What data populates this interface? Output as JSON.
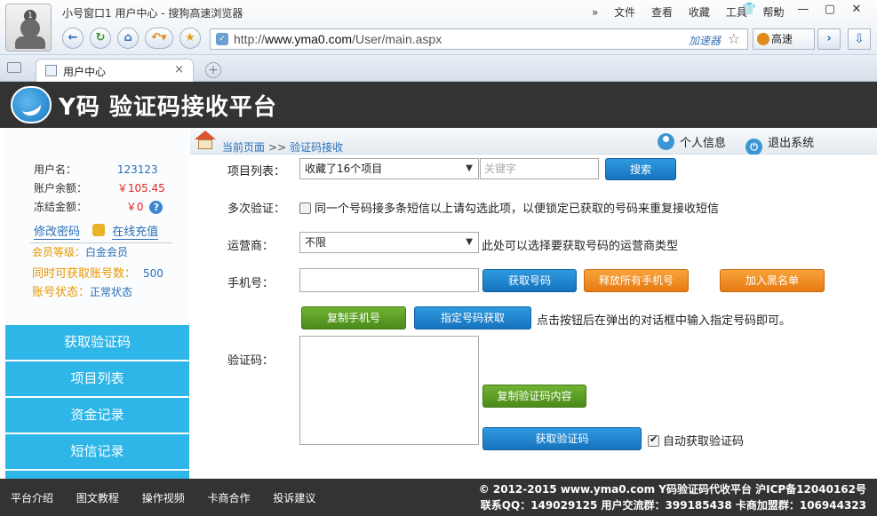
{
  "browser": {
    "window_title": "小号窗口1 用户中心 - 搜狗高速浏览器",
    "avatar_badge": "1",
    "menu": [
      "»",
      "文件",
      "查看",
      "收藏",
      "工具",
      "帮助"
    ],
    "url_prefix": "http://",
    "url_domain": "www.yma0.com",
    "url_path": "/User/main.aspx",
    "accelerator": "加速器",
    "speed_label": "高速",
    "tab_label": "用户中心",
    "tab_close": "×",
    "new_tab": "+"
  },
  "site": {
    "title": "Y码 验证码接收平台"
  },
  "user": {
    "username_label": "用户名：",
    "username": "123123",
    "balance_label": "账户余额：",
    "balance": "￥105.45",
    "frozen_label": "冻结金额：",
    "frozen": "￥0",
    "change_password": "修改密码",
    "recharge": "在线充值",
    "level_label": "会员等级：",
    "level": "白金会员",
    "concurrent_label": "同时可获取账号数：",
    "concurrent": "500",
    "status_label": "账号状态：",
    "status": "正常状态"
  },
  "nav": [
    "获取验证码",
    "项目列表",
    "资金记录",
    "短信记录"
  ],
  "breadcrumb": {
    "current": "当前页面",
    "sep": ">>",
    "page": "验证码接收"
  },
  "header_actions": {
    "profile": "个人信息",
    "logout": "退出系统"
  },
  "form": {
    "project_label": "项目列表：",
    "project_value": "收藏了16个项目",
    "keyword_placeholder": "关键字",
    "search_button": "搜索",
    "multi_label": "多次验证：",
    "multi_hint": "同一个号码接多条短信以上请勾选此项，以便锁定已获取的号码来重复接收短信",
    "carrier_label": "运营商：",
    "carrier_value": "不限",
    "carrier_hint": "此处可以选择要获取号码的运营商类型",
    "phone_label": "手机号：",
    "get_number": "获取号码",
    "release_all": "释放所有手机号",
    "blacklist": "加入黑名单",
    "copy_phone": "复制手机号",
    "specify_number": "指定号码获取",
    "specify_hint": "点击按钮后在弹出的对话框中输入指定号码即可。",
    "code_label": "验证码：",
    "copy_code": "复制验证码内容",
    "get_code": "获取验证码",
    "auto_get": "自动获取验证码"
  },
  "footer": {
    "links": [
      "平台介绍",
      "图文教程",
      "操作视频",
      "卡商合作",
      "投诉建议"
    ],
    "copyright": "© 2012-2015 www.yma0.com Y码验证码代收平台 沪ICP备12040162号",
    "contact": "联系QQ：149029125 用户交流群：399185438 卡商加盟群：106944323"
  }
}
